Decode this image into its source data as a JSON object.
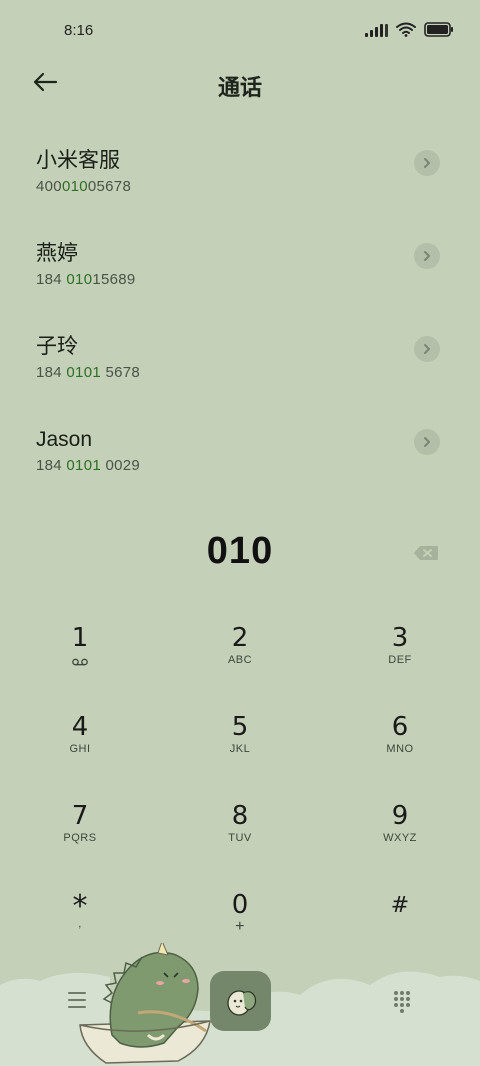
{
  "status": {
    "time": "8:16"
  },
  "header": {
    "title": "通话"
  },
  "contacts": [
    {
      "name": "小米客服",
      "num_pre": "400",
      "num_hl": "010",
      "num_post": "05678"
    },
    {
      "name": "燕婷",
      "num_pre": "184 ",
      "num_hl": "010",
      "num_post": "15689"
    },
    {
      "name": "子玲",
      "num_pre": "184 ",
      "num_hl": "0101",
      "num_post": " 5678"
    },
    {
      "name": "Jason",
      "num_pre": "184 ",
      "num_hl": "0101",
      "num_post": " 0029"
    }
  ],
  "dialer": {
    "input": "010"
  },
  "keypad": [
    {
      "digit": "1",
      "sub": ""
    },
    {
      "digit": "2",
      "sub": "ABC"
    },
    {
      "digit": "3",
      "sub": "DEF"
    },
    {
      "digit": "4",
      "sub": "GHI"
    },
    {
      "digit": "5",
      "sub": "JKL"
    },
    {
      "digit": "6",
      "sub": "MNO"
    },
    {
      "digit": "7",
      "sub": "PQRS"
    },
    {
      "digit": "8",
      "sub": "TUV"
    },
    {
      "digit": "9",
      "sub": "WXYZ"
    },
    {
      "digit": "*",
      "sub": ","
    },
    {
      "digit": "0",
      "sub": "+"
    },
    {
      "digit": "#",
      "sub": ""
    }
  ],
  "colors": {
    "background": "#c4d0b8",
    "highlight": "#2e6f23",
    "call_button": "#74876a"
  },
  "icons": {
    "back": "arrow-left-icon",
    "chevron": "chevron-right-icon",
    "backspace": "backspace-icon",
    "voicemail": "voicemail-icon",
    "menu": "menu-icon",
    "dialpad": "dialpad-icon"
  }
}
